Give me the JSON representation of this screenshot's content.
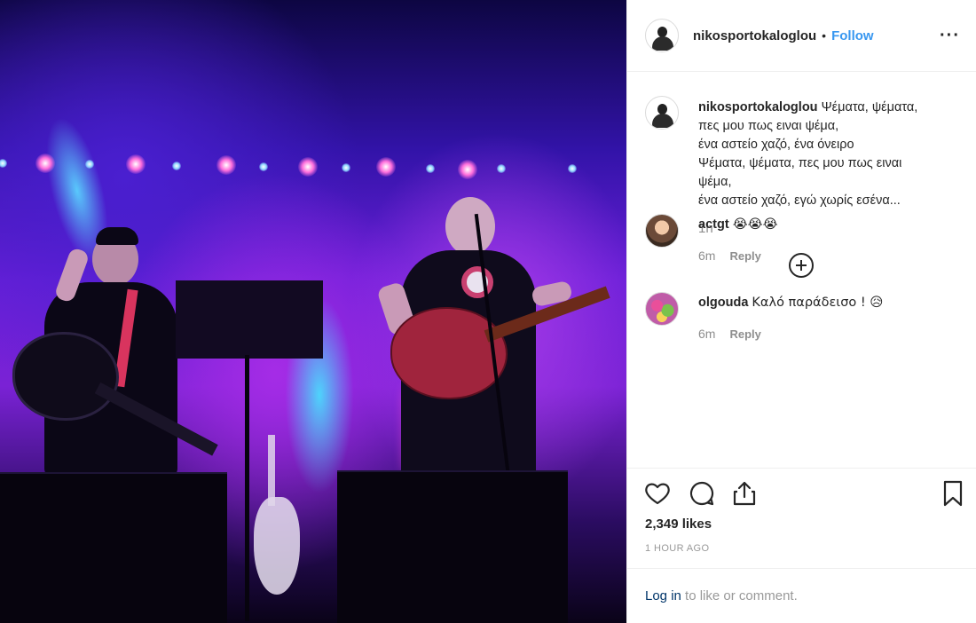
{
  "post": {
    "username": "nikosportokaloglou",
    "follow_separator": "•",
    "follow_label": "Follow",
    "more_label": "···"
  },
  "caption": {
    "username": "nikosportokaloglou",
    "lines": [
      "Ψέματα, ψέματα,",
      "πες μου πως ειναι ψέμα,",
      "ένα αστείο χαζό, ένα όνειρο",
      "Ψέματα, ψέματα, πες μου πως ειναι",
      "ψέμα,",
      "ένα αστείο χαζό, εγώ χωρίς εσένα..."
    ],
    "time": "1h"
  },
  "comments": [
    {
      "username": "actgt",
      "text": "😭😭😭",
      "time": "6m",
      "reply_label": "Reply"
    },
    {
      "username": "olgouda",
      "text": "Καλό παράδεισο ! 😥",
      "time": "6m",
      "reply_label": "Reply"
    }
  ],
  "icons": {
    "like": "heart-icon",
    "comment": "comment-icon",
    "share": "share-icon",
    "save": "bookmark-icon",
    "load_more": "plus-circle-icon"
  },
  "stats": {
    "likes": "2,349 likes",
    "posted_ago": "1 HOUR AGO"
  },
  "login_prompt": {
    "link": "Log in",
    "rest": " to like or comment."
  },
  "colors": {
    "accent": "#3897f0",
    "stage_purple": "#7a22d5",
    "stage_cyan": "#5ad2ff"
  }
}
